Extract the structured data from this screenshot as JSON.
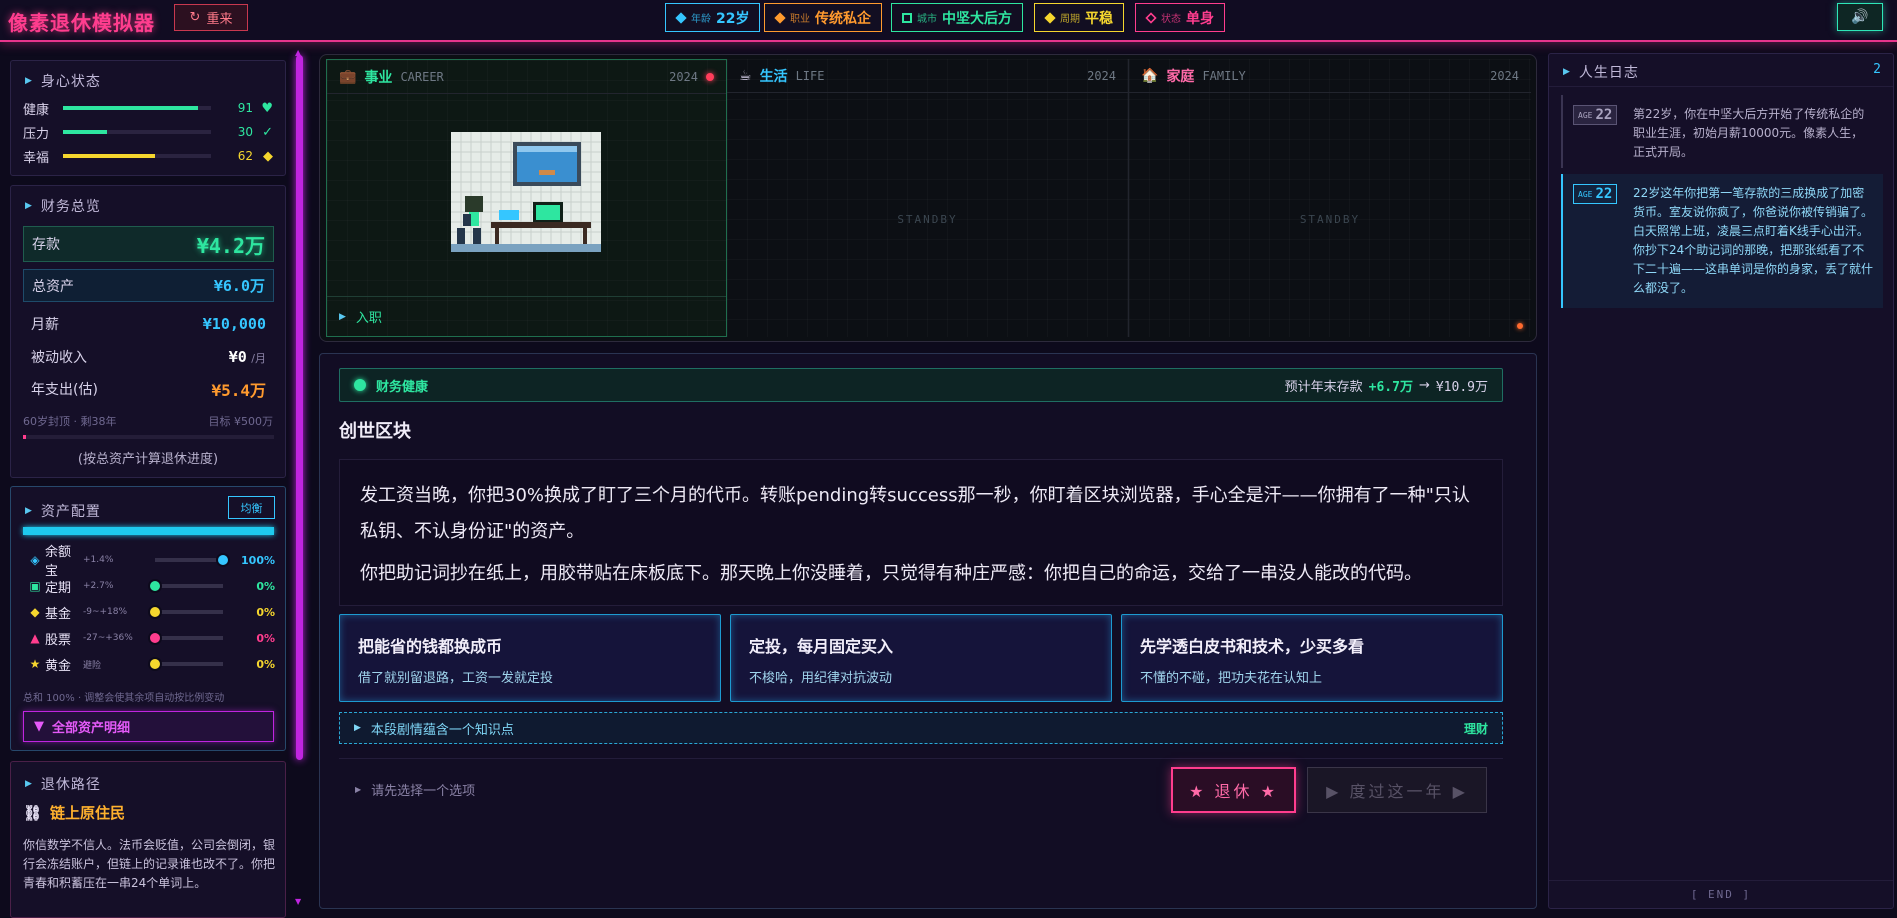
{
  "topbar": {
    "title": "像素退休模拟器",
    "reset_label": "重来",
    "reset_icon": "↻",
    "chips": [
      {
        "label": "年龄",
        "value": "22岁",
        "color": "#35c6ff"
      },
      {
        "label": "职业",
        "value": "传统私企",
        "color": "#ff9a2e"
      },
      {
        "label": "城市",
        "value": "中坚大后方",
        "color": "#2ee6a0"
      },
      {
        "label": "周期",
        "value": "平稳",
        "color": "#f5d62e"
      },
      {
        "label": "状态",
        "value": "单身",
        "color": "#ff3d8e"
      }
    ],
    "sound_icon": "🔊"
  },
  "wellbeing": {
    "title": "身心状态",
    "rows": [
      {
        "name": "健康",
        "value": "91",
        "level": 0.91,
        "color": "#2ee6a0",
        "symbol": "♥"
      },
      {
        "name": "压力",
        "value": "30",
        "level": 0.3,
        "color": "#2ee6a0",
        "symbol": "✓"
      },
      {
        "name": "幸福",
        "value": "62",
        "level": 0.62,
        "color": "#f5d62e",
        "symbol": "◆"
      }
    ]
  },
  "finance": {
    "title": "财务总览",
    "savings_label": "存款",
    "savings_value": "¥4.2万",
    "assets_label": "总资产",
    "assets_value": "¥6.0万",
    "salary_label": "月薪",
    "salary_value": "¥10,000",
    "passive_label": "被动收入",
    "passive_value": "¥0",
    "passive_unit": "/月",
    "expense_label": "年支出(估)",
    "expense_value": "¥5.4万",
    "cap_label": "60岁封顶 · 剩38年",
    "target_label": "目标 ¥500万",
    "progress": 0.01,
    "progress_note": "(按总资产计算退休进度)"
  },
  "allocation": {
    "title": "资产配置",
    "balance_btn": "均衡",
    "rows": [
      {
        "icon": "◈",
        "name": "余额宝",
        "rate": "+1.4%",
        "pct": "100%",
        "level": 1.0,
        "color": "#35c6ff"
      },
      {
        "icon": "▣",
        "name": "定期",
        "rate": "+2.7%",
        "pct": "0%",
        "level": 0,
        "color": "#2ee6a0"
      },
      {
        "icon": "◆",
        "name": "基金",
        "rate": "-9~+18%",
        "pct": "0%",
        "level": 0,
        "color": "#f5d62e"
      },
      {
        "icon": "▲",
        "name": "股票",
        "rate": "-27~+36%",
        "pct": "0%",
        "level": 0,
        "color": "#ff3d8e"
      },
      {
        "icon": "★",
        "name": "黄金",
        "rate": "避险",
        "pct": "0%",
        "level": 0,
        "color": "#f5d62e"
      }
    ],
    "note": "总和 100% · 调整会使其余项自动按比例变动",
    "detail_btn": "全部资产明细"
  },
  "path": {
    "title": "退休路径",
    "name": "链上原住民",
    "icon": "⛓",
    "desc": "你信数学不信人。法币会贬值，公司会倒闭，银行会冻结账户，但链上的记录谁也改不了。你把青春和积蓄压在一串24个单词上。"
  },
  "stage": {
    "career": {
      "icon": "💼",
      "title": "事业",
      "en": "CAREER",
      "year": "2024",
      "footer": "入职"
    },
    "life": {
      "icon": "☕",
      "title": "生活",
      "en": "LIFE",
      "year": "2024",
      "standby": "STANDBY"
    },
    "family": {
      "icon": "🏠",
      "title": "家庭",
      "en": "FAMILY",
      "year": "2024",
      "standby": "STANDBY"
    }
  },
  "main": {
    "health_label": "财务健康",
    "forecast_label": "预计年末存款",
    "forecast_delta": "+6.7万",
    "forecast_arrow": "→",
    "forecast_total": "¥10.9万",
    "chapter_title": "创世区块",
    "story_p1": "发工资当晚，你把30%换成了盯了三个月的代币。转账pending转success那一秒，你盯着区块浏览器，手心全是汗——你拥有了一种\"只认私钥、不认身份证\"的资产。",
    "story_p2": "你把助记词抄在纸上，用胶带贴在床板底下。那天晚上你没睡着，只觉得有种庄严感：你把自己的命运，交给了一串没人能改的代码。",
    "options": [
      {
        "title": "把能省的钱都换成币",
        "sub": "借了就别留退路，工资一发就定投"
      },
      {
        "title": "定投，每月固定买入",
        "sub": "不梭哈，用纪律对抗波动"
      },
      {
        "title": "先学透白皮书和技术，少买多看",
        "sub": "不懂的不碰，把功夫花在认知上"
      }
    ],
    "knowledge_label": "本段剧情蕴含一个知识点",
    "knowledge_tag": "理财",
    "prompt": "请先选择一个选项",
    "retire_btn": "★ 退休 ★",
    "year_btn": "▶ 度过这一年 ▶"
  },
  "log": {
    "title": "人生日志",
    "count": "2",
    "entries": [
      {
        "age_label": "AGE",
        "age": "22",
        "text": "第22岁，你在中坚大后方开始了传统私企的职业生涯，初始月薪10000元。像素人生，正式开局。"
      },
      {
        "age_label": "AGE",
        "age": "22",
        "text": "22岁这年你把第一笔存款的三成换成了加密货币。室友说你疯了，你爸说你被传销骗了。白天照常上班，凌晨三点盯着K线手心出汗。你抄下24个助记词的那晚，把那张纸看了不下二十遍——这串单词是你的身家，丢了就什么都没了。"
      }
    ],
    "end_label": "[ END ]"
  },
  "colors": {
    "accent_pink": "#ff3d8e",
    "accent_cyan": "#35c6ff",
    "accent_green": "#2ee6a0",
    "accent_yellow": "#f5d62e",
    "accent_orange": "#ff9a2e",
    "accent_purple": "#c025e0"
  }
}
